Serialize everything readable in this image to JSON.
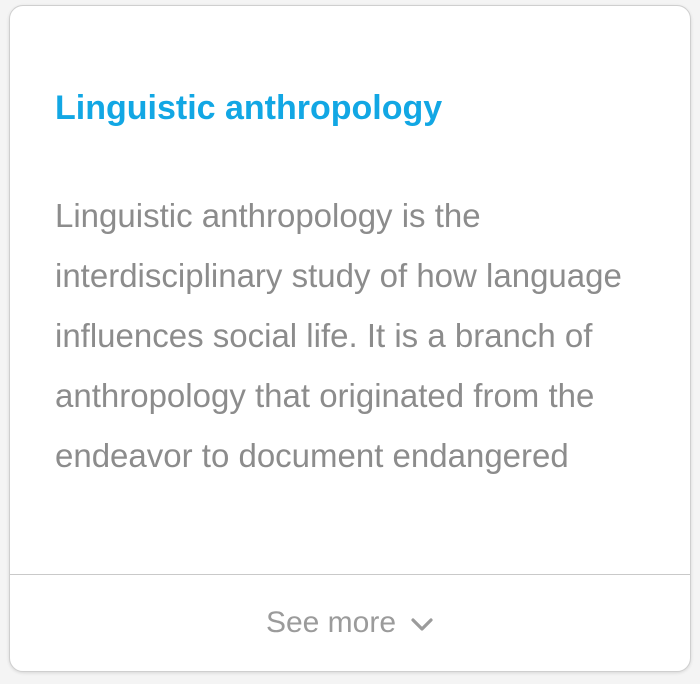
{
  "card": {
    "title": "Linguistic anthropology",
    "body": "Linguistic anthropology is the interdisciplinary study of how language influences social life. It is a branch of anthropology that originated from the endeavor to document endangered",
    "see_more_label": "See more",
    "chevron_icon": "chevron-down-icon"
  },
  "colors": {
    "title": "#12a7e4",
    "body_text": "#8c8c8c",
    "see_more": "#9b9b9b",
    "divider": "#c9c9c9",
    "card_border": "#cfcfcf"
  }
}
